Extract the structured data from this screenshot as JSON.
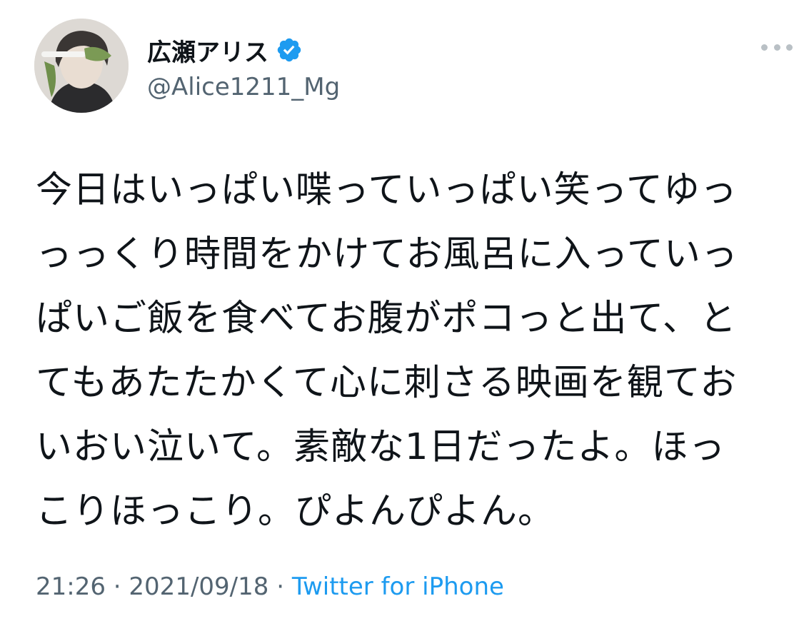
{
  "user": {
    "display_name": "広瀬アリス",
    "handle": "@Alice1211_Mg",
    "verified_icon": "verified-badge-icon",
    "avatar_icon": "profile-avatar"
  },
  "menu": {
    "icon": "more-options-icon"
  },
  "tweet": {
    "lines": [
      "今日はいっぱい喋っていっぱい笑ってゆっ",
      "っっくり時間をかけてお風呂に入っていっ",
      "ぱいご飯を食べてお腹がポコっと出て、と",
      "てもあたたかくて心に刺さる映画を観てお",
      "いおい泣いて。素敵な1日だったよ。ほっ",
      "こりほっこり。ぴよんぴよん。"
    ]
  },
  "meta": {
    "time": "21:26",
    "separator": " · ",
    "date": "2021/09/18",
    "source": "Twitter for iPhone"
  },
  "colors": {
    "text": "#0f1419",
    "secondary": "#536471",
    "link": "#1d9bf0",
    "verified": "#1d9bf0"
  }
}
